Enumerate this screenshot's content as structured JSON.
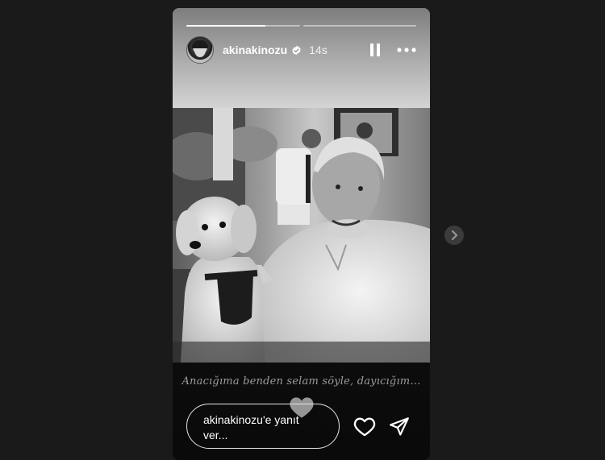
{
  "story": {
    "progress_segments": [
      {
        "fill_fraction": 0.7
      },
      {
        "fill_fraction": 0.0
      }
    ],
    "header": {
      "avatar_icon": "avatar",
      "username": "akinakinozu",
      "verified_icon": "verified-badge-icon",
      "time_ago": "14s",
      "pause_icon": "pause-icon",
      "more_icon": "more-icon"
    },
    "caption": "Anacığıma benden selam söyle, dayıcığım…",
    "reply": {
      "placeholder": "akinakinozu'e yanıt ver..."
    },
    "actions": {
      "like_icon": "heart-icon",
      "share_icon": "send-icon"
    },
    "floating_heart_icon": "heart-icon"
  },
  "navigation": {
    "next_icon": "chevron-right-icon"
  },
  "colors": {
    "page_background": "#1a1a1a",
    "next_button_background": "#3b3b3b",
    "text_primary": "#ffffff",
    "caption_text": "#9c9c9c"
  }
}
